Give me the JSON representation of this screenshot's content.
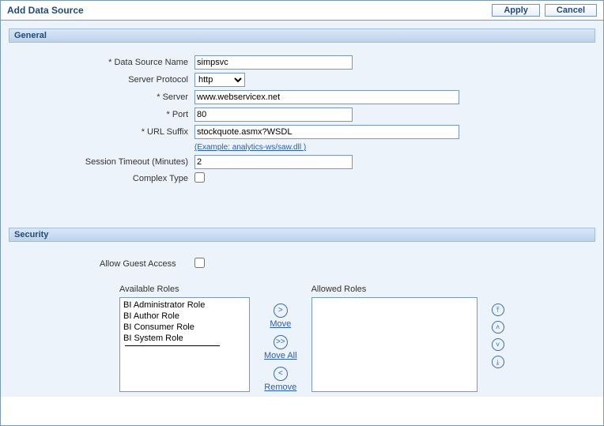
{
  "header": {
    "title": "Add Data Source",
    "apply": "Apply",
    "cancel": "Cancel"
  },
  "general": {
    "heading": "General",
    "labels": {
      "dsname": "* Data Source Name",
      "protocol": "Server Protocol",
      "server": "* Server",
      "port": "* Port",
      "url": "* URL Suffix",
      "example": "(Example: analytics-ws/saw.dll )",
      "session": "Session Timeout (Minutes)",
      "complex": "Complex Type"
    },
    "values": {
      "dsname": "simpsvc",
      "protocol": "http",
      "server": "www.webservicex.net",
      "port": "80",
      "url": "stockquote.asmx?WSDL",
      "session": "2",
      "complex": false
    }
  },
  "security": {
    "heading": "Security",
    "labels": {
      "guest": "Allow Guest Access",
      "available": "Available Roles",
      "allowed": "Allowed Roles",
      "move": "Move",
      "moveall": "Move All",
      "remove": "Remove"
    },
    "values": {
      "guest": false
    },
    "available_roles": [
      "BI Administrator Role",
      "BI Author Role",
      "BI Consumer Role",
      "BI System Role"
    ],
    "allowed_roles": []
  },
  "icons": {
    "move": ">",
    "moveall": ">>",
    "remove": "<",
    "top": "⤒",
    "up": "˄",
    "down": "˅",
    "bottom": "⤓"
  }
}
